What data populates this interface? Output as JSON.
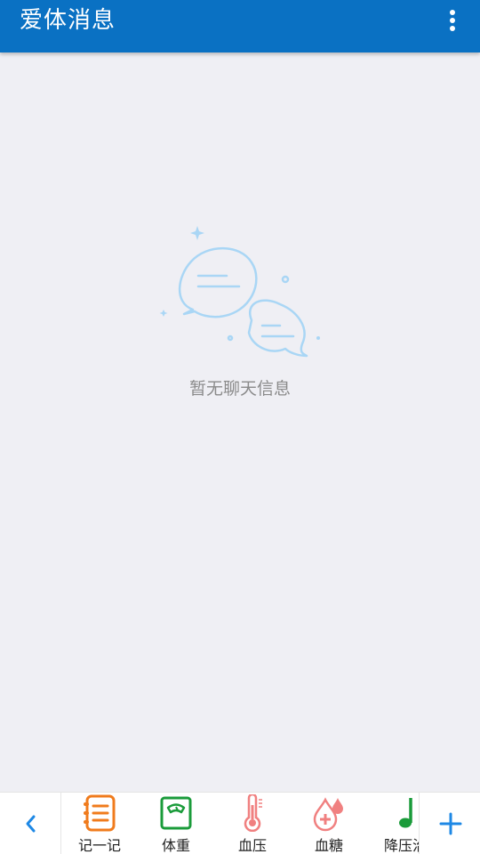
{
  "app_bar": {
    "title": "爱体消息",
    "background": "#0a71c3",
    "more_icon": "more-vertical-icon"
  },
  "empty_state": {
    "message": "暂无聊天信息",
    "icon": "chat-bubbles-icon",
    "icon_color": "#a9d6f5"
  },
  "bottom_bar": {
    "left_icon": "chevron-left-icon",
    "right_icon": "plus-icon",
    "accent": "#1e88e5",
    "tools": [
      {
        "label": "记一记",
        "icon": "notebook-icon",
        "color": "#f07b1c"
      },
      {
        "label": "体重",
        "icon": "weight-scale-icon",
        "color": "#1a9b3a"
      },
      {
        "label": "血压",
        "icon": "thermometer-icon",
        "color": "#f08080"
      },
      {
        "label": "血糖",
        "icon": "blood-drop-icon",
        "color": "#f08080"
      },
      {
        "label": "降压治",
        "icon": "music-note-icon",
        "color": "#1a9b3a"
      }
    ]
  }
}
